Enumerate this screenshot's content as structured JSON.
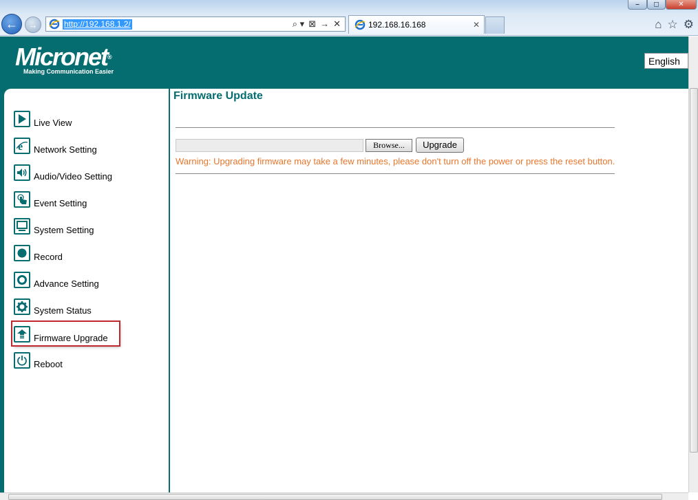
{
  "browser": {
    "address_url": "http://192.168.1.2/",
    "tab_title": "192.168.16.168",
    "tab_close": "✕",
    "window_buttons": {
      "minimize": "–",
      "maximize": "◻",
      "close": "✕"
    },
    "nav_buttons": {
      "back": "←",
      "forward": "→"
    },
    "address_tools": [
      "⌕ ▾",
      "⊠",
      "→",
      "✕"
    ],
    "chrome_icons": [
      "⌂",
      "☆",
      "⚙"
    ],
    "icons": {
      "back": "back-arrow-icon",
      "forward": "forward-arrow-icon",
      "page": "ie-page-icon",
      "home": "home-icon",
      "favorites": "star-icon",
      "tools": "gear-icon"
    }
  },
  "header": {
    "brand": "Micronet",
    "brand_mark": "®",
    "tagline": "Making Communication Easier",
    "language": "English",
    "accent_color": "#056d6f"
  },
  "nav": {
    "items": [
      {
        "label": "Live View",
        "icon": "play-icon"
      },
      {
        "label": "Network Setting",
        "icon": "ie-icon"
      },
      {
        "label": "Audio/Video Setting",
        "icon": "speaker-icon"
      },
      {
        "label": "Event Setting",
        "icon": "touch-icon"
      },
      {
        "label": "System Setting",
        "icon": "monitor-icon"
      },
      {
        "label": "Record",
        "icon": "record-icon"
      },
      {
        "label": "Advance Setting",
        "icon": "ring-icon"
      },
      {
        "label": "System Status",
        "icon": "gear-icon"
      },
      {
        "label": "Firmware Upgrade",
        "icon": "upload-icon",
        "selected": true
      },
      {
        "label": "Reboot",
        "icon": "power-icon"
      }
    ]
  },
  "content": {
    "title": "Firmware Update",
    "file_path_value": "",
    "browse_label": "Browse...",
    "upgrade_label": "Upgrade",
    "warning": "Warning: Upgrading firmware may take a few minutes, please don't turn off the power or press the reset button.",
    "warning_color": "#e8762b"
  }
}
